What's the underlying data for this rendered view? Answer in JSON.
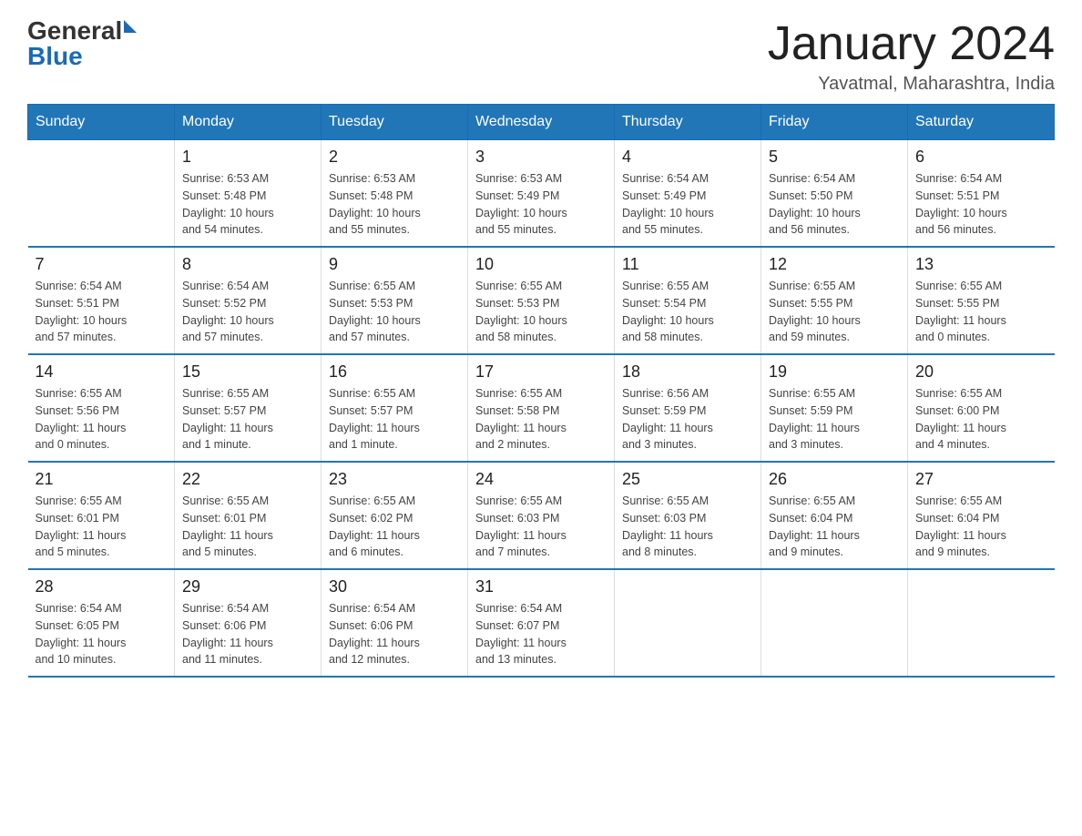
{
  "header": {
    "logo_general": "General",
    "logo_blue": "Blue",
    "month_title": "January 2024",
    "location": "Yavatmal, Maharashtra, India"
  },
  "days_of_week": [
    "Sunday",
    "Monday",
    "Tuesday",
    "Wednesday",
    "Thursday",
    "Friday",
    "Saturday"
  ],
  "weeks": [
    [
      {
        "day": "",
        "info": ""
      },
      {
        "day": "1",
        "info": "Sunrise: 6:53 AM\nSunset: 5:48 PM\nDaylight: 10 hours\nand 54 minutes."
      },
      {
        "day": "2",
        "info": "Sunrise: 6:53 AM\nSunset: 5:48 PM\nDaylight: 10 hours\nand 55 minutes."
      },
      {
        "day": "3",
        "info": "Sunrise: 6:53 AM\nSunset: 5:49 PM\nDaylight: 10 hours\nand 55 minutes."
      },
      {
        "day": "4",
        "info": "Sunrise: 6:54 AM\nSunset: 5:49 PM\nDaylight: 10 hours\nand 55 minutes."
      },
      {
        "day": "5",
        "info": "Sunrise: 6:54 AM\nSunset: 5:50 PM\nDaylight: 10 hours\nand 56 minutes."
      },
      {
        "day": "6",
        "info": "Sunrise: 6:54 AM\nSunset: 5:51 PM\nDaylight: 10 hours\nand 56 minutes."
      }
    ],
    [
      {
        "day": "7",
        "info": "Sunrise: 6:54 AM\nSunset: 5:51 PM\nDaylight: 10 hours\nand 57 minutes."
      },
      {
        "day": "8",
        "info": "Sunrise: 6:54 AM\nSunset: 5:52 PM\nDaylight: 10 hours\nand 57 minutes."
      },
      {
        "day": "9",
        "info": "Sunrise: 6:55 AM\nSunset: 5:53 PM\nDaylight: 10 hours\nand 57 minutes."
      },
      {
        "day": "10",
        "info": "Sunrise: 6:55 AM\nSunset: 5:53 PM\nDaylight: 10 hours\nand 58 minutes."
      },
      {
        "day": "11",
        "info": "Sunrise: 6:55 AM\nSunset: 5:54 PM\nDaylight: 10 hours\nand 58 minutes."
      },
      {
        "day": "12",
        "info": "Sunrise: 6:55 AM\nSunset: 5:55 PM\nDaylight: 10 hours\nand 59 minutes."
      },
      {
        "day": "13",
        "info": "Sunrise: 6:55 AM\nSunset: 5:55 PM\nDaylight: 11 hours\nand 0 minutes."
      }
    ],
    [
      {
        "day": "14",
        "info": "Sunrise: 6:55 AM\nSunset: 5:56 PM\nDaylight: 11 hours\nand 0 minutes."
      },
      {
        "day": "15",
        "info": "Sunrise: 6:55 AM\nSunset: 5:57 PM\nDaylight: 11 hours\nand 1 minute."
      },
      {
        "day": "16",
        "info": "Sunrise: 6:55 AM\nSunset: 5:57 PM\nDaylight: 11 hours\nand 1 minute."
      },
      {
        "day": "17",
        "info": "Sunrise: 6:55 AM\nSunset: 5:58 PM\nDaylight: 11 hours\nand 2 minutes."
      },
      {
        "day": "18",
        "info": "Sunrise: 6:56 AM\nSunset: 5:59 PM\nDaylight: 11 hours\nand 3 minutes."
      },
      {
        "day": "19",
        "info": "Sunrise: 6:55 AM\nSunset: 5:59 PM\nDaylight: 11 hours\nand 3 minutes."
      },
      {
        "day": "20",
        "info": "Sunrise: 6:55 AM\nSunset: 6:00 PM\nDaylight: 11 hours\nand 4 minutes."
      }
    ],
    [
      {
        "day": "21",
        "info": "Sunrise: 6:55 AM\nSunset: 6:01 PM\nDaylight: 11 hours\nand 5 minutes."
      },
      {
        "day": "22",
        "info": "Sunrise: 6:55 AM\nSunset: 6:01 PM\nDaylight: 11 hours\nand 5 minutes."
      },
      {
        "day": "23",
        "info": "Sunrise: 6:55 AM\nSunset: 6:02 PM\nDaylight: 11 hours\nand 6 minutes."
      },
      {
        "day": "24",
        "info": "Sunrise: 6:55 AM\nSunset: 6:03 PM\nDaylight: 11 hours\nand 7 minutes."
      },
      {
        "day": "25",
        "info": "Sunrise: 6:55 AM\nSunset: 6:03 PM\nDaylight: 11 hours\nand 8 minutes."
      },
      {
        "day": "26",
        "info": "Sunrise: 6:55 AM\nSunset: 6:04 PM\nDaylight: 11 hours\nand 9 minutes."
      },
      {
        "day": "27",
        "info": "Sunrise: 6:55 AM\nSunset: 6:04 PM\nDaylight: 11 hours\nand 9 minutes."
      }
    ],
    [
      {
        "day": "28",
        "info": "Sunrise: 6:54 AM\nSunset: 6:05 PM\nDaylight: 11 hours\nand 10 minutes."
      },
      {
        "day": "29",
        "info": "Sunrise: 6:54 AM\nSunset: 6:06 PM\nDaylight: 11 hours\nand 11 minutes."
      },
      {
        "day": "30",
        "info": "Sunrise: 6:54 AM\nSunset: 6:06 PM\nDaylight: 11 hours\nand 12 minutes."
      },
      {
        "day": "31",
        "info": "Sunrise: 6:54 AM\nSunset: 6:07 PM\nDaylight: 11 hours\nand 13 minutes."
      },
      {
        "day": "",
        "info": ""
      },
      {
        "day": "",
        "info": ""
      },
      {
        "day": "",
        "info": ""
      }
    ]
  ]
}
